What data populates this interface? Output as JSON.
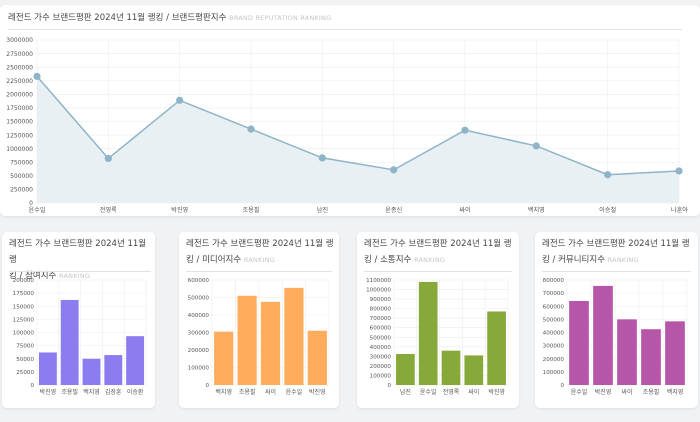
{
  "line_card": {
    "title": "레전드 가수 브랜드평판 2024년 11월 랭킹 / 브랜드평판지수",
    "subtitle": "BRAND REPUTATION RANKING"
  },
  "cards": [
    {
      "title_line1": "레전드 가수 브랜드평판 2024년 11월 랭",
      "title_line2": "킹 / 참여지수",
      "subtitle": "RANKING"
    },
    {
      "title_line1": "레전드 가수 브랜드평판 2024년 11월 랭",
      "title_line2": "킹 / 미디어지수",
      "subtitle": "RANKING"
    },
    {
      "title_line1": "레전드 가수 브랜드평판 2024년 11월 랭",
      "title_line2": "킹 / 소통지수",
      "subtitle": "RANKING"
    },
    {
      "title_line1": "레전드 가수 브랜드평판 2024년 11월 랭",
      "title_line2": "킹 / 커뮤니티지수",
      "subtitle": "RANKING"
    }
  ],
  "colors": {
    "line": "#8fb4c8",
    "area": "#e8f0f4",
    "point": "#8fb4c8",
    "bars": [
      "#8b7cf0",
      "#ffad5c",
      "#86a93a",
      "#b556a8"
    ],
    "grid": "#ececec",
    "axis_text": "#555555"
  },
  "chart_data": [
    {
      "type": "area",
      "categories": [
        "윤수일",
        "전영록",
        "박진영",
        "조용필",
        "남진",
        "윤종신",
        "싸이",
        "백지영",
        "이승철",
        "나훈아"
      ],
      "values": [
        2330000,
        820000,
        1890000,
        1360000,
        830000,
        610000,
        1340000,
        1050000,
        520000,
        590000
      ],
      "ylim": [
        0,
        3000000
      ],
      "yticks": [
        0,
        250000,
        500000,
        750000,
        1000000,
        1250000,
        1500000,
        1750000,
        2000000,
        2250000,
        2500000,
        2750000,
        3000000
      ],
      "grid": true
    },
    {
      "type": "bar",
      "categories": [
        "박진영",
        "조용필",
        "백지영",
        "김장훈",
        "이승환"
      ],
      "values": [
        62000,
        162000,
        50000,
        57000,
        93000
      ],
      "ylim": [
        0,
        200000
      ],
      "yticks": [
        0,
        25000,
        50000,
        75000,
        100000,
        125000,
        150000,
        175000,
        200000
      ],
      "grid": true
    },
    {
      "type": "bar",
      "categories": [
        "백지영",
        "조용필",
        "싸이",
        "윤수일",
        "박진영"
      ],
      "values": [
        305000,
        510000,
        475000,
        555000,
        310000
      ],
      "ylim": [
        0,
        600000
      ],
      "yticks": [
        0,
        100000,
        200000,
        300000,
        400000,
        500000,
        600000
      ],
      "grid": true
    },
    {
      "type": "bar",
      "categories": [
        "남진",
        "윤수일",
        "전영록",
        "싸이",
        "박진영"
      ],
      "values": [
        325000,
        1080000,
        360000,
        310000,
        770000
      ],
      "ylim": [
        0,
        1100000
      ],
      "yticks": [
        0,
        100000,
        200000,
        300000,
        400000,
        500000,
        600000,
        700000,
        800000,
        900000,
        1000000,
        1100000
      ],
      "grid": true
    },
    {
      "type": "bar",
      "categories": [
        "윤수일",
        "박진영",
        "싸이",
        "조용필",
        "백지영"
      ],
      "values": [
        640000,
        755000,
        500000,
        425000,
        485000
      ],
      "ylim": [
        0,
        800000
      ],
      "yticks": [
        0,
        100000,
        200000,
        300000,
        400000,
        500000,
        600000,
        700000,
        800000
      ],
      "grid": true
    }
  ]
}
